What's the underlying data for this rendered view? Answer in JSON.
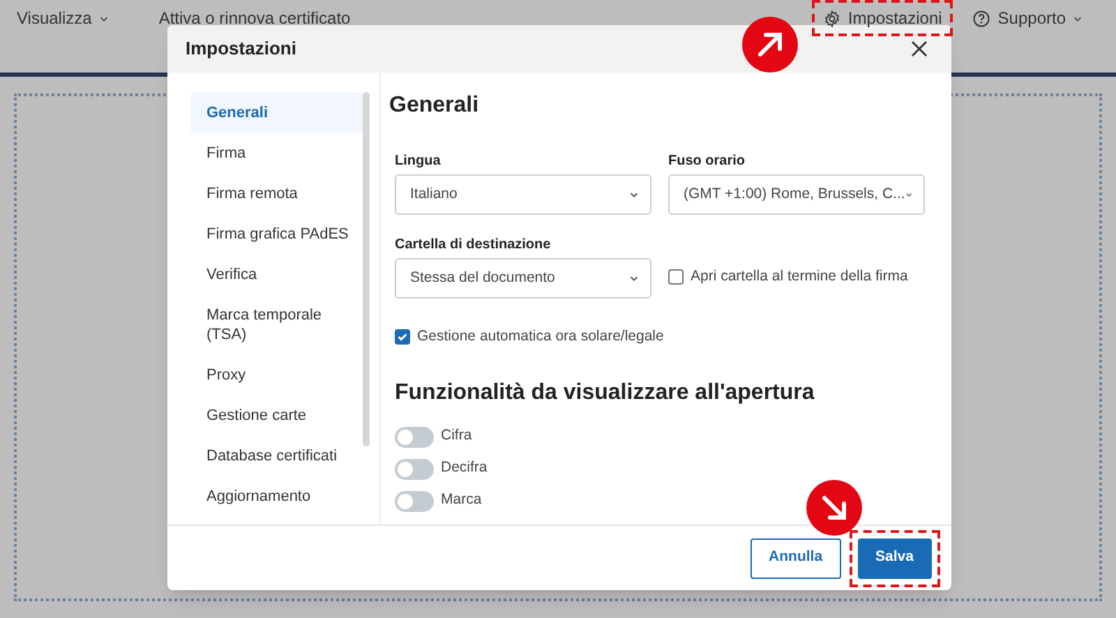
{
  "top_bar": {
    "items": [
      {
        "label": "Visualizza",
        "kind": "menu",
        "highlighted": false
      },
      {
        "label": "Attiva o rinnova certificato",
        "kind": "link",
        "highlighted": false
      },
      {
        "label": "Impostazioni",
        "kind": "settings",
        "highlighted": true
      },
      {
        "label": "Supporto",
        "kind": "help",
        "highlighted": false
      }
    ]
  },
  "dialog": {
    "title": "Impostazioni",
    "sidebar": {
      "items": [
        {
          "label": "Generali",
          "selected": true
        },
        {
          "label": "Firma",
          "selected": false
        },
        {
          "label": "Firma remota",
          "selected": false
        },
        {
          "label": "Firma grafica PAdES",
          "selected": false
        },
        {
          "label": "Verifica",
          "selected": false
        },
        {
          "label": "Marca temporale (TSA)",
          "selected": false
        },
        {
          "label": "Proxy",
          "selected": false
        },
        {
          "label": "Gestione carte",
          "selected": false
        },
        {
          "label": "Database certificati",
          "selected": false
        },
        {
          "label": "Aggiornamento",
          "selected": false
        }
      ]
    },
    "section_title": "Generali",
    "fields": [
      {
        "label": "Lingua",
        "value": "Italiano"
      },
      {
        "label": "Fuso orario",
        "value": "(GMT +1:00) Rome, Brussels, C..."
      },
      {
        "label": "Cartella di destinazione",
        "value": "Stessa del documento"
      }
    ],
    "checkboxes": [
      {
        "label": "Apri cartella al termine della firma",
        "checked": false
      },
      {
        "label": "Gestione automatica ora solare/legale",
        "checked": true
      }
    ],
    "features_title": "Funzionalità da visualizzare all'apertura",
    "toggles": [
      {
        "label": "Cifra",
        "on": false
      },
      {
        "label": "Decifra",
        "on": false
      },
      {
        "label": "Marca",
        "on": false
      }
    ],
    "buttons": [
      {
        "label": "Annulla",
        "kind": "secondary",
        "highlighted": false
      },
      {
        "label": "Salva",
        "kind": "primary",
        "highlighted": true
      }
    ]
  }
}
